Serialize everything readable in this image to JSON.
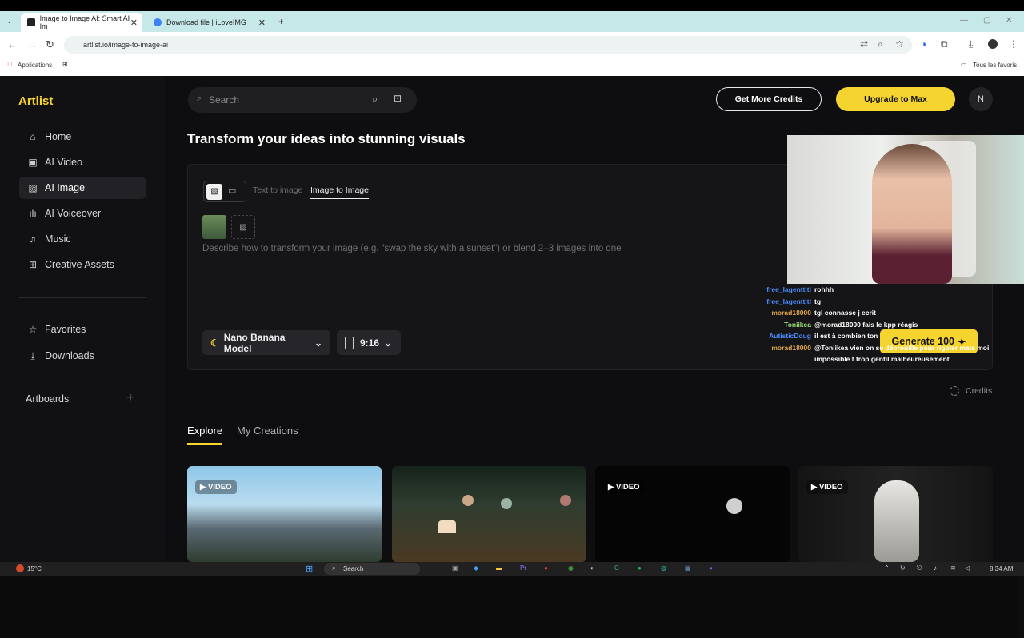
{
  "browser": {
    "tabs": [
      {
        "label": "Image to Image AI: Smart AI Im",
        "active": true
      },
      {
        "label": "Download file | iLoveIMG",
        "active": false
      }
    ],
    "url": "artlist.io/image-to-image-ai",
    "bookmarks_apps": "Applications",
    "bookmarks_all": "Tous les favoris"
  },
  "app": {
    "logo": "Artlist",
    "search_placeholder": "Search",
    "get_credits": "Get More Credits",
    "upgrade": "Upgrade to Max",
    "avatar_initial": "N",
    "accent_color": "#f6d430"
  },
  "sidebar": {
    "items": [
      {
        "label": "Home",
        "icon": "home-icon"
      },
      {
        "label": "AI Video",
        "icon": "video-icon"
      },
      {
        "label": "AI Image",
        "icon": "image-icon",
        "selected": true
      },
      {
        "label": "AI Voiceover",
        "icon": "waveform-icon"
      },
      {
        "label": "Music",
        "icon": "music-note-icon"
      },
      {
        "label": "Creative Assets",
        "icon": "grid-icon"
      },
      {
        "label": "Favorites",
        "icon": "star-icon"
      },
      {
        "label": "Downloads",
        "icon": "download-icon"
      }
    ],
    "artboards": "Artboards"
  },
  "main": {
    "headline": "Transform your ideas into stunning visuals",
    "subtabs": [
      "Text to image",
      "Image to Image"
    ],
    "prompt_placeholder": "Describe how to transform your image (e.g. “swap the sky with a sunset”) or blend 2–3 images into one",
    "model": "Nano Banana Model",
    "ratio": "9:16",
    "generate": "Generate 100",
    "credits": "Credits",
    "gallery_tabs": [
      "Explore",
      "My Creations"
    ],
    "gallery_badge": "VIDEO"
  },
  "chat": [
    {
      "user": "free_lagenttitl",
      "msg": "rohhh",
      "color": "#4a8cff"
    },
    {
      "user": "free_lagenttitl",
      "msg": "tg",
      "color": "#4a8cff"
    },
    {
      "user": "morad18000",
      "msg": "tgl connasse j ecrit",
      "color": "#e0a54a"
    },
    {
      "user": "Toniikea",
      "msg": "@morad18000 fais le kpp réagis",
      "color": "#9be07a"
    },
    {
      "user": "AutisticDoug",
      "msg": "il est à combien ton",
      "color": "#4a8cff"
    },
    {
      "user": "morad18000",
      "msg": "@Toniikea vien on se débrouille pour rigoler mais moi",
      "color": "#e0a54a"
    },
    {
      "user": "",
      "msg": "impossible t trop gentil malheureusement",
      "color": "#e0a54a"
    }
  ],
  "taskbar": {
    "weather": "15°C",
    "search": "Search",
    "time": "8:34 AM"
  }
}
